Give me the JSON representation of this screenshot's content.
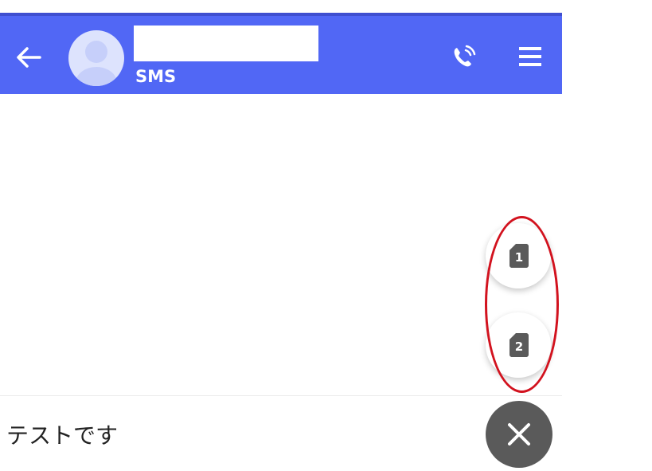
{
  "header": {
    "subtitle": "SMS",
    "name_redacted": "",
    "background_color": "#5167f5",
    "icons": {
      "back": "arrow-left-icon",
      "call": "phone-call-icon",
      "menu": "hamburger-menu-icon"
    }
  },
  "sim_options": [
    {
      "number": "1",
      "icon": "sim-card-icon"
    },
    {
      "number": "2",
      "icon": "sim-card-icon"
    }
  ],
  "composer": {
    "message_text": "テストです"
  },
  "fab": {
    "icon": "close-icon",
    "color": "#5a5a5a"
  },
  "annotation": {
    "color": "#d2121e"
  }
}
